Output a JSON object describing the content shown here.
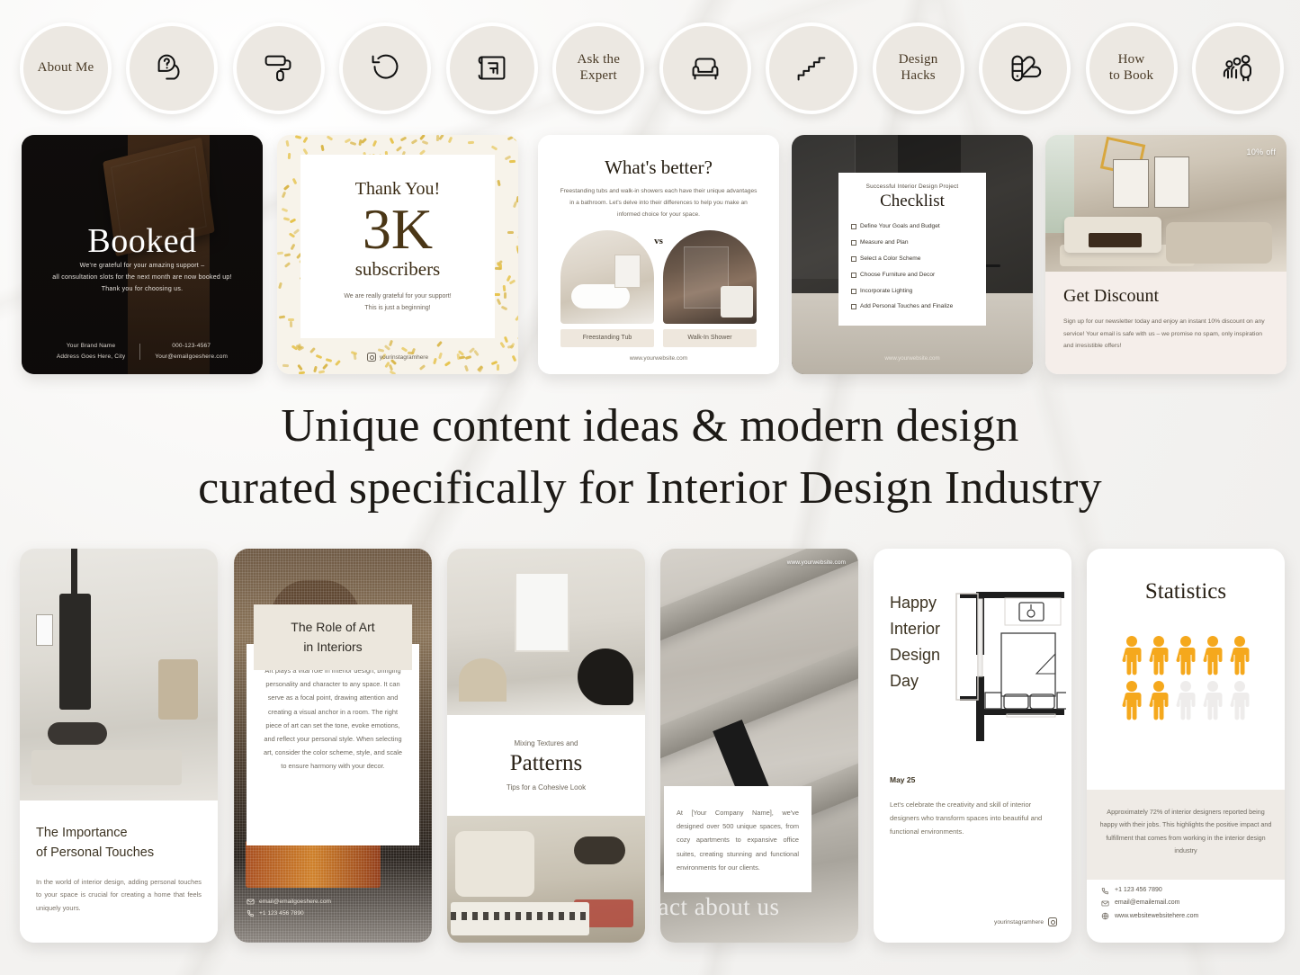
{
  "highlights": [
    {
      "label": "About Me",
      "icon": "text"
    },
    {
      "label": "",
      "icon": "question-bubble-icon"
    },
    {
      "label": "",
      "icon": "paint-roller-icon"
    },
    {
      "label": "",
      "icon": "undo-arrow-icon"
    },
    {
      "label": "",
      "icon": "floor-plan-icon"
    },
    {
      "label": "Ask the\nExpert",
      "icon": "text"
    },
    {
      "label": "",
      "icon": "armchair-icon"
    },
    {
      "label": "",
      "icon": "stairs-icon"
    },
    {
      "label": "Design\nHacks",
      "icon": "text"
    },
    {
      "label": "",
      "icon": "color-swatch-icon"
    },
    {
      "label": "How\nto Book",
      "icon": "text"
    },
    {
      "label": "",
      "icon": "people-group-icon"
    }
  ],
  "headline": {
    "line1": "Unique content ideas & modern design",
    "line2": "curated specifically for Interior Design Industry"
  },
  "posts": {
    "booked": {
      "title": "Booked",
      "body": "We're grateful for your amazing support –\nall consultation slots for the next month are now booked up!\nThank you for choosing us.",
      "brand_name": "Your Brand Name",
      "address": "Address Goes Here, City",
      "phone": "000-123-4567",
      "email": "Your@emailgoeshere.com"
    },
    "thanks": {
      "kicker": "Thank You!",
      "number": "3K",
      "unit": "subscribers",
      "note": "We are really grateful for your support!\nThis is just a beginning!",
      "handle": "yourinstagramhere"
    },
    "whats_better": {
      "title": "What's better?",
      "intro": "Freestanding tubs and walk-in showers each have their unique advantages in a bathroom. Let's delve into their differences to help you make an informed choice for your space.",
      "vs": "vs",
      "option_left": "Freestanding Tub",
      "option_right": "Walk-In Shower",
      "url": "www.yourwebsite.com"
    },
    "checklist": {
      "kicker": "Successful Interior Design Project",
      "title": "Checklist",
      "items": [
        "Define Your Goals and Budget",
        "Measure and Plan",
        "Select a Color Scheme",
        "Choose Furniture and Decor",
        "Incorporate Lighting",
        "Add Personal Touches and Finalize"
      ],
      "url": "www.yourwebsite.com"
    },
    "discount": {
      "badge": "10% off",
      "title": "Get Discount",
      "body": "Sign up for our newsletter today and enjoy an instant 10% discount on any service! Your email is safe with us – we promise no spam, only inspiration and irresistible offers!"
    }
  },
  "stories": {
    "personal_touches": {
      "title_line1": "The Importance",
      "title_line2": "of Personal Touches",
      "body": "In the world of interior design, adding personal touches to your space is crucial for creating a home that feels uniquely yours."
    },
    "role_of_art": {
      "title_line1": "The Role of Art",
      "title_line2": "in Interiors",
      "body": "Art plays a vital role in interior design, bringing personality and character to any space. It can serve as a focal point, drawing attention and creating a visual anchor in a room. The right piece of art can set the tone, evoke emotions, and reflect your personal style. When selecting art, consider the color scheme, style, and scale to ensure harmony with your decor.",
      "email": "email@emailgoeshere.com",
      "phone": "+1 123 456 7890"
    },
    "patterns": {
      "kicker": "Mixing Textures and",
      "title": "Patterns",
      "subtitle": "Tips for a Cohesive Look"
    },
    "fact": {
      "url": "www.yourwebsite.com",
      "body": "At [Your Company Name], we've designed over 500 unique spaces, from cozy apartments to expansive office suites, creating stunning and functional environments for our clients.",
      "watermark": "Fact about us"
    },
    "design_day": {
      "title": "Happy\nInterior\nDesign\nDay",
      "date": "May 25",
      "body": "Let's celebrate the creativity and skill of interior designers who transform spaces into beautiful and functional environments.",
      "handle": "yourinstagramhere"
    },
    "statistics": {
      "title": "Statistics",
      "note": "Approximately 72% of interior designers reported being happy with their jobs. This highlights the positive impact and fulfillment that comes from working in the interior design industry",
      "phone": "+1 123 456 7890",
      "email": "email@emailemail.com",
      "website": "www.websitewebsitehere.com"
    }
  },
  "chart_data": {
    "type": "pictogram",
    "title": "Statistics",
    "categories": [
      "Happy interior designers"
    ],
    "values": [
      72
    ],
    "total_icons": 10,
    "filled_icons": 7,
    "filled_color": "#f5a81c",
    "empty_color": "#eeeceb",
    "unit": "%",
    "annotation": "Approximately 72% of interior designers reported being happy with their jobs."
  },
  "colors": {
    "circle_bg": "#ece8e2",
    "brand_brown": "#4a3b27",
    "beige": "#efebe6",
    "orange": "#f5a81c"
  }
}
